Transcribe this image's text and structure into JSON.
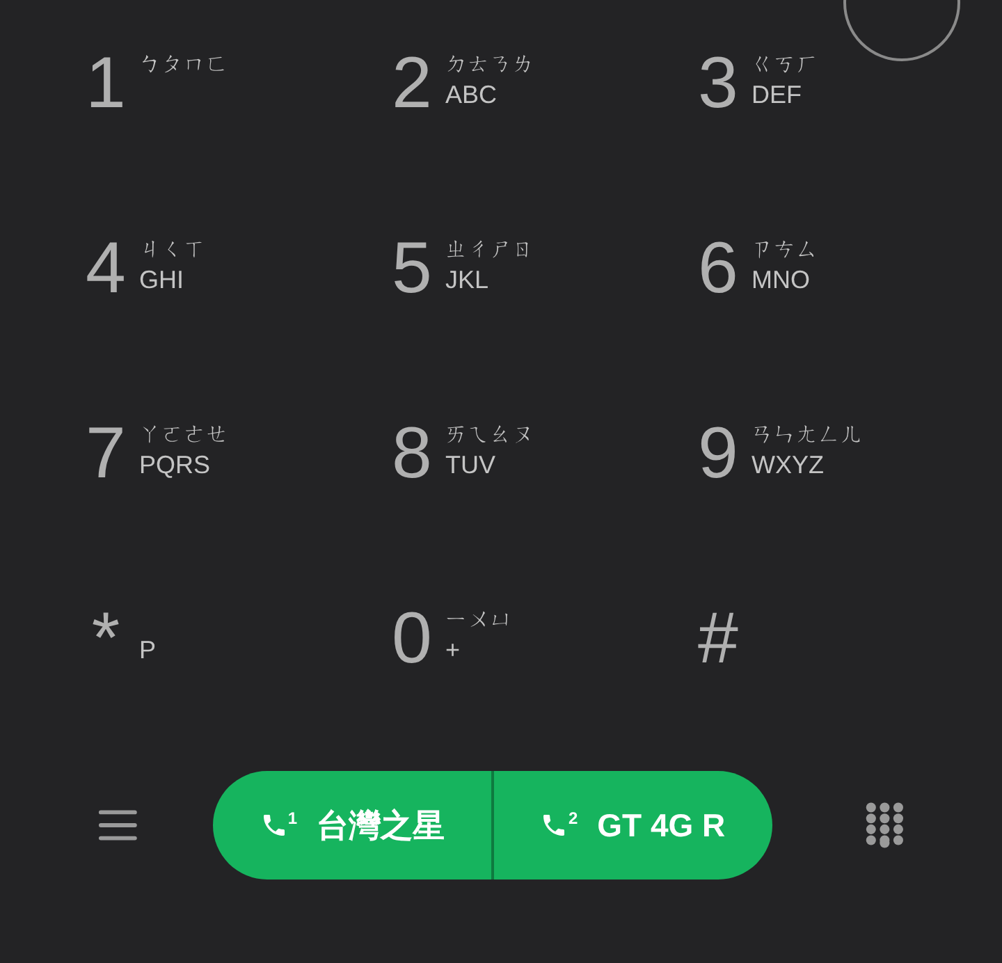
{
  "keys": [
    {
      "digit": "1",
      "zhuyin": "ㄅㄆㄇㄈ"
    },
    {
      "digit": "2",
      "zhuyin": "ㄉㄊㄋㄌ",
      "letters": "ABC"
    },
    {
      "digit": "3",
      "zhuyin": "ㄍㄎㄏ",
      "letters": "DEF"
    },
    {
      "digit": "4",
      "zhuyin": "ㄐㄑㄒ",
      "letters": "GHI"
    },
    {
      "digit": "5",
      "zhuyin": "ㄓㄔㄕㄖ",
      "letters": "JKL"
    },
    {
      "digit": "6",
      "zhuyin": "ㄗㄘㄙ",
      "letters": "MNO"
    },
    {
      "digit": "7",
      "zhuyin": "ㄚㄛㄜㄝ",
      "letters": "PQRS"
    },
    {
      "digit": "8",
      "zhuyin": "ㄞㄟㄠㄡ",
      "letters": "TUV"
    },
    {
      "digit": "9",
      "zhuyin": "ㄢㄣㄤㄥㄦ",
      "letters": "WXYZ"
    },
    {
      "digit": "*",
      "letters": "P"
    },
    {
      "digit": "0",
      "zhuyin": "ㄧㄨㄩ",
      "letters": "+"
    },
    {
      "digit": "#"
    }
  ],
  "call_buttons": [
    {
      "sim": "1",
      "label": "台灣之星"
    },
    {
      "sim": "2",
      "label": "GT 4G R"
    }
  ]
}
